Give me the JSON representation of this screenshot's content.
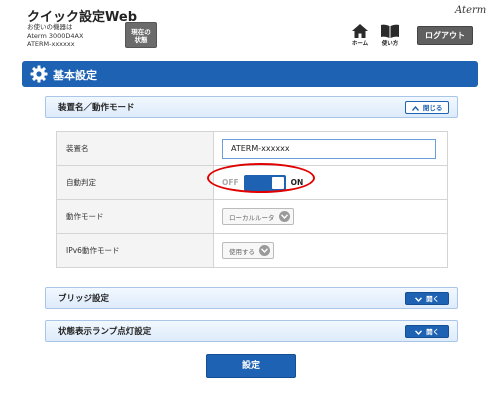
{
  "header": {
    "app_title": "クイック設定Web",
    "device_info_label": "お使いの機器は",
    "device_model": "Aterm 3000D4AX",
    "device_name": "ATERM-xxxxxx",
    "status_button": "現在の\n状態",
    "brand": "Aterm",
    "home_label": "ホーム",
    "help_label": "使い方",
    "logout_label": "ログアウト"
  },
  "section": {
    "title": "基本設定",
    "icon": "gear-icon"
  },
  "panel_device_mode": {
    "title": "装置名／動作モード",
    "toggle_label": "閉じる",
    "rows": [
      {
        "label": "装置名",
        "value": "ATERM-xxxxxx"
      },
      {
        "label": "自動判定",
        "off_label": "OFF",
        "on_label": "ON",
        "state": "ON"
      },
      {
        "label": "動作モード",
        "value": "ローカルルータ"
      },
      {
        "label": "IPv6動作モード",
        "value": "使用する"
      }
    ]
  },
  "panel_bridge": {
    "title": "ブリッジ設定",
    "toggle_label": "開く"
  },
  "panel_lamp": {
    "title": "状態表示ランプ点灯設定",
    "toggle_label": "開く"
  },
  "submit": {
    "label": "設定"
  },
  "colors": {
    "accent": "#1d62b3",
    "highlight": "#e00000"
  }
}
